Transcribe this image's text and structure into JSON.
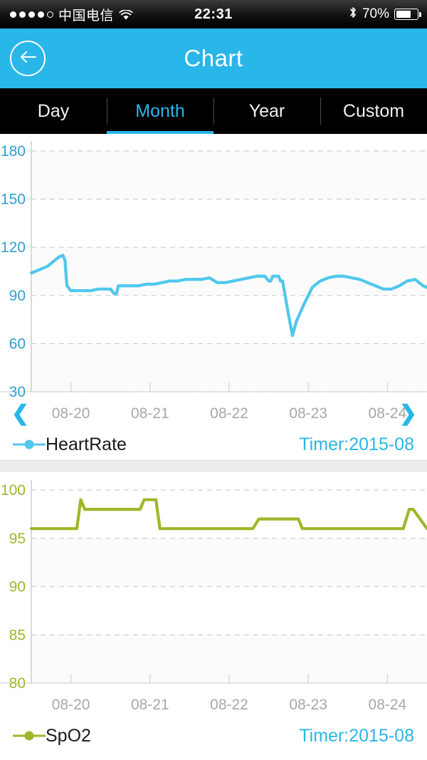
{
  "status_bar": {
    "signal_dots_filled": 4,
    "signal_dots_total": 5,
    "carrier": "中国电信",
    "wifi_icon": "wifi-icon",
    "time": "22:31",
    "bluetooth_icon": "bluetooth-icon",
    "battery_percent": "70%",
    "battery_level": 70
  },
  "navbar": {
    "back_icon": "back-arrow-icon",
    "title": "Chart"
  },
  "tabs": [
    {
      "label": "Day",
      "active": false
    },
    {
      "label": "Month",
      "active": true
    },
    {
      "label": "Year",
      "active": false
    },
    {
      "label": "Custom",
      "active": false
    }
  ],
  "colors": {
    "accent": "#29b6e8",
    "heart_rate": "#4fc8ec",
    "spo2": "#9cb82a",
    "tabbar_bg": "#000000",
    "grid": "#cccccc",
    "axis_label_gray": "#a8a8a8"
  },
  "nav_controls": {
    "prev_icon": "chevron-left-icon",
    "next_icon": "chevron-right-icon"
  },
  "chart_data": [
    {
      "id": "heart-rate-chart",
      "type": "line",
      "title": "HeartRate",
      "series_name": "HeartRate",
      "color": "#4fc8ec",
      "legend_label": "HeartRate",
      "timer_label": "Timer:2015-08",
      "ylabel": "",
      "xlabel": "",
      "ylim": [
        30,
        180
      ],
      "yticks": [
        30,
        60,
        90,
        120,
        150,
        180
      ],
      "xticks": [
        "08-20",
        "08-21",
        "08-22",
        "08-23",
        "08-24"
      ],
      "grid": true,
      "legend_position": "bottom-left",
      "x": [
        0.0,
        0.01,
        0.02,
        0.03,
        0.04,
        0.05,
        0.06,
        0.07,
        0.08,
        0.085,
        0.09,
        0.1,
        0.11,
        0.13,
        0.15,
        0.17,
        0.19,
        0.2,
        0.21,
        0.215,
        0.22,
        0.23,
        0.25,
        0.27,
        0.29,
        0.31,
        0.33,
        0.35,
        0.37,
        0.39,
        0.41,
        0.43,
        0.45,
        0.47,
        0.49,
        0.51,
        0.53,
        0.55,
        0.57,
        0.585,
        0.59,
        0.6,
        0.605,
        0.61,
        0.62,
        0.625,
        0.63,
        0.635,
        0.64,
        0.65,
        0.66,
        0.67,
        0.69,
        0.71,
        0.73,
        0.75,
        0.77,
        0.79,
        0.81,
        0.83,
        0.85,
        0.87,
        0.89,
        0.91,
        0.93,
        0.95,
        0.97,
        0.99,
        1.0
      ],
      "y": [
        104,
        105,
        106,
        107,
        108,
        110,
        112,
        114,
        115,
        112,
        96,
        93,
        93,
        93,
        93,
        94,
        94,
        94,
        91,
        91,
        96,
        96,
        96,
        96,
        97,
        97,
        98,
        99,
        99,
        100,
        100,
        100,
        101,
        98,
        98,
        99,
        100,
        101,
        102,
        102,
        102,
        99,
        99,
        102,
        102,
        102,
        99,
        99,
        92,
        78,
        65,
        74,
        85,
        95,
        99,
        101,
        102,
        102,
        101,
        100,
        98,
        96,
        94,
        94,
        96,
        99,
        100,
        96,
        95
      ]
    },
    {
      "id": "spo2-chart",
      "type": "line",
      "title": "SpO2",
      "series_name": "SpO2",
      "color": "#9cb82a",
      "legend_label": "SpO2",
      "timer_label": "Timer:2015-08",
      "ylabel": "",
      "xlabel": "",
      "ylim": [
        80,
        100
      ],
      "yticks": [
        80,
        85,
        90,
        95,
        100
      ],
      "xticks": [
        "08-20",
        "08-21",
        "08-22",
        "08-23",
        "08-24"
      ],
      "grid": true,
      "legend_position": "bottom-left",
      "x": [
        0.0,
        0.1,
        0.115,
        0.125,
        0.135,
        0.15,
        0.26,
        0.275,
        0.285,
        0.3,
        0.315,
        0.325,
        0.4,
        0.415,
        0.425,
        0.435,
        0.56,
        0.575,
        0.585,
        0.6,
        0.66,
        0.675,
        0.685,
        0.7,
        0.94,
        0.955,
        0.965,
        1.0
      ],
      "y": [
        96,
        96,
        96,
        99,
        98,
        98,
        98,
        98,
        99,
        99,
        99,
        96,
        96,
        96,
        96,
        96,
        96,
        97,
        97,
        97,
        97,
        97,
        96,
        96,
        96,
        98,
        98,
        96
      ]
    }
  ]
}
